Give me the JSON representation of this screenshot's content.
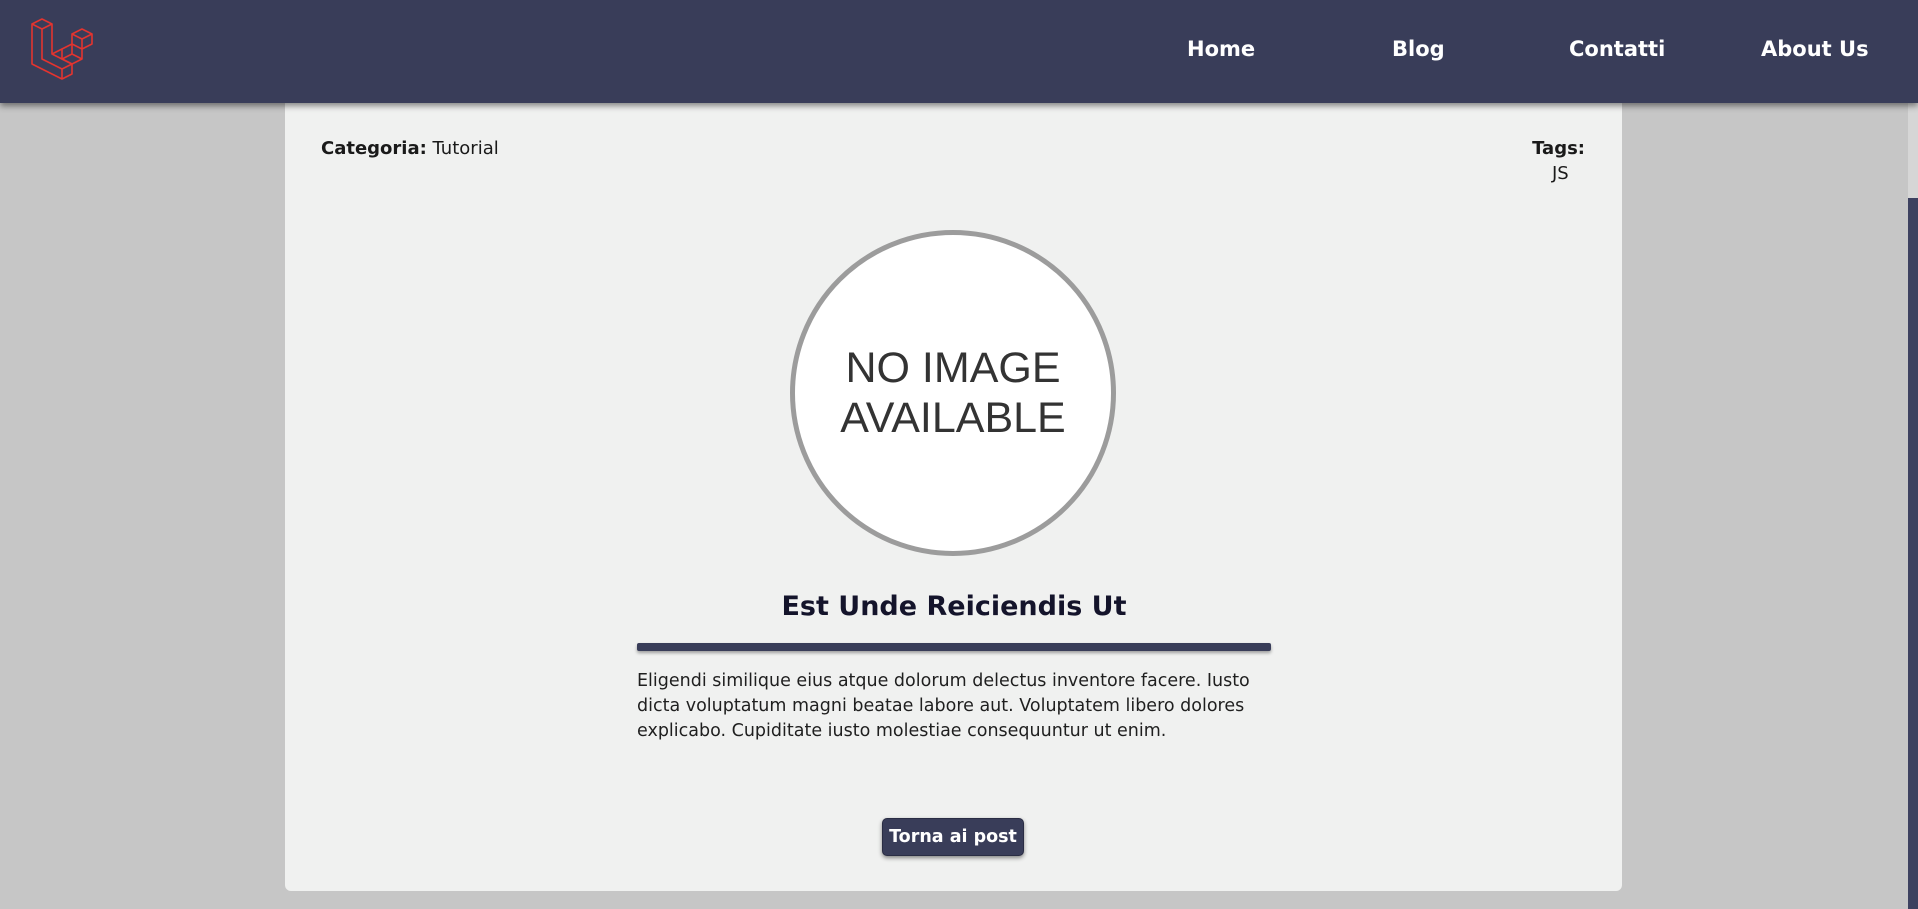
{
  "header": {
    "logo_icon": "laravel-logo-icon",
    "nav": {
      "home": "Home",
      "blog": "Blog",
      "contatti": "Contatti",
      "about": "About Us"
    },
    "background_color": "#393d59"
  },
  "post": {
    "category_label": "Categoria:",
    "category_value": "Tutorial",
    "tags_label": "Tags:",
    "tags": [
      "JS"
    ],
    "image_placeholder": "NO IMAGE AVAILABLE",
    "title": "Est Unde Reiciendis Ut",
    "body": "Eligendi similique eius atque dolorum delectus inventore facere. Iusto dicta voluptatum magni beatae labore aut. Voluptatem libero dolores explicabo. Cupiditate iusto molestiae consequuntur ut enim.",
    "back_button": "Torna ai post"
  },
  "colors": {
    "accent": "#393d59",
    "logo": "#e3342f",
    "page_background": "#c6c6c6",
    "card_background": "#f0f1f0"
  }
}
